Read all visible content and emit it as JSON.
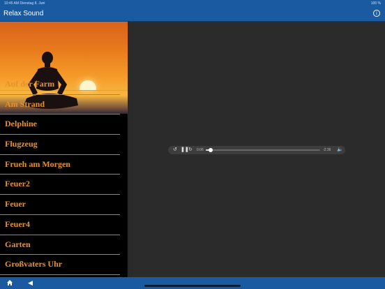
{
  "status": {
    "time_date": "10:45 AM  Dienstag 8. Juni",
    "battery": "100 %"
  },
  "navbar": {
    "title": "Relax Sound",
    "info_icon": "info-icon"
  },
  "menu": {
    "items": [
      "Auf der Farm",
      "Am Strand",
      "Delphine",
      "Flugzeug",
      "Frueh am Morgen",
      "Feuer2",
      "Feuer",
      "Feuer4",
      "Garten",
      "Großvaters Uhr"
    ]
  },
  "player": {
    "elapsed": "0:06",
    "remaining": "-2:36",
    "progress": 0.04,
    "volume": 1.0
  },
  "tabbar": {
    "home_icon": "home-icon",
    "back_icon": "back-arrow-icon"
  },
  "colors": {
    "bar_blue": "#1a5aa0",
    "item_text": "#e8922a"
  }
}
